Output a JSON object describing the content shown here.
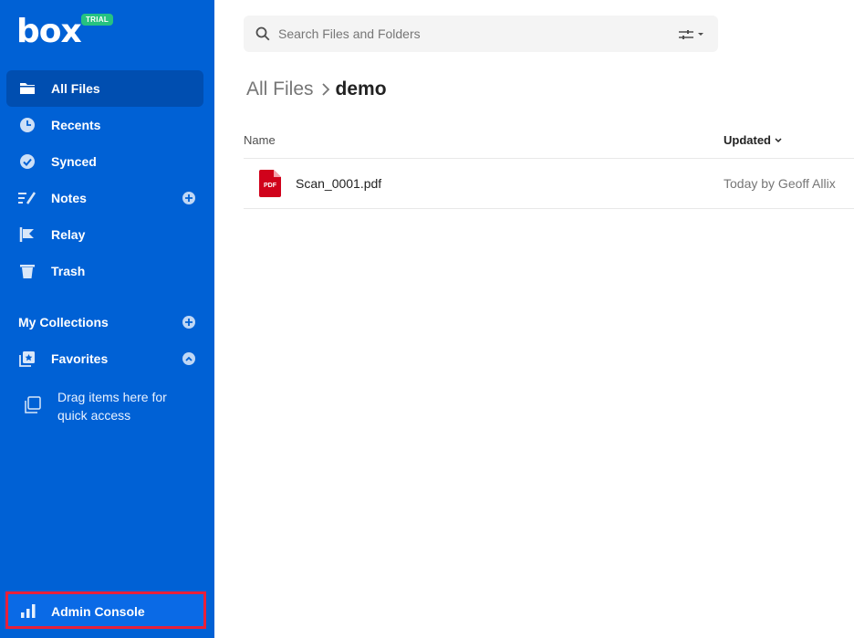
{
  "brand": {
    "logo_text": "box",
    "badge": "TRIAL"
  },
  "sidebar": {
    "nav": [
      {
        "label": "All Files",
        "icon": "folder-icon",
        "active": true
      },
      {
        "label": "Recents",
        "icon": "clock-icon"
      },
      {
        "label": "Synced",
        "icon": "check-circle-icon"
      },
      {
        "label": "Notes",
        "icon": "notes-icon"
      },
      {
        "label": "Relay",
        "icon": "relay-icon"
      },
      {
        "label": "Trash",
        "icon": "trash-icon"
      }
    ],
    "collections_label": "My Collections",
    "favorites_label": "Favorites",
    "drag_hint": "Drag items here for quick access",
    "admin_label": "Admin Console"
  },
  "search": {
    "placeholder": "Search Files and Folders"
  },
  "breadcrumb": {
    "root": "All Files",
    "current": "demo"
  },
  "table": {
    "columns": {
      "name": "Name",
      "updated": "Updated"
    },
    "rows": [
      {
        "name": "Scan_0001.pdf",
        "updated": "Today by Geoff Allix",
        "type_badge": "PDF"
      }
    ]
  },
  "colors": {
    "sidebar": "#0061d5",
    "active": "#004eb0",
    "highlight": "#e8203a",
    "trial": "#26c281",
    "pdf": "#d0021b"
  }
}
